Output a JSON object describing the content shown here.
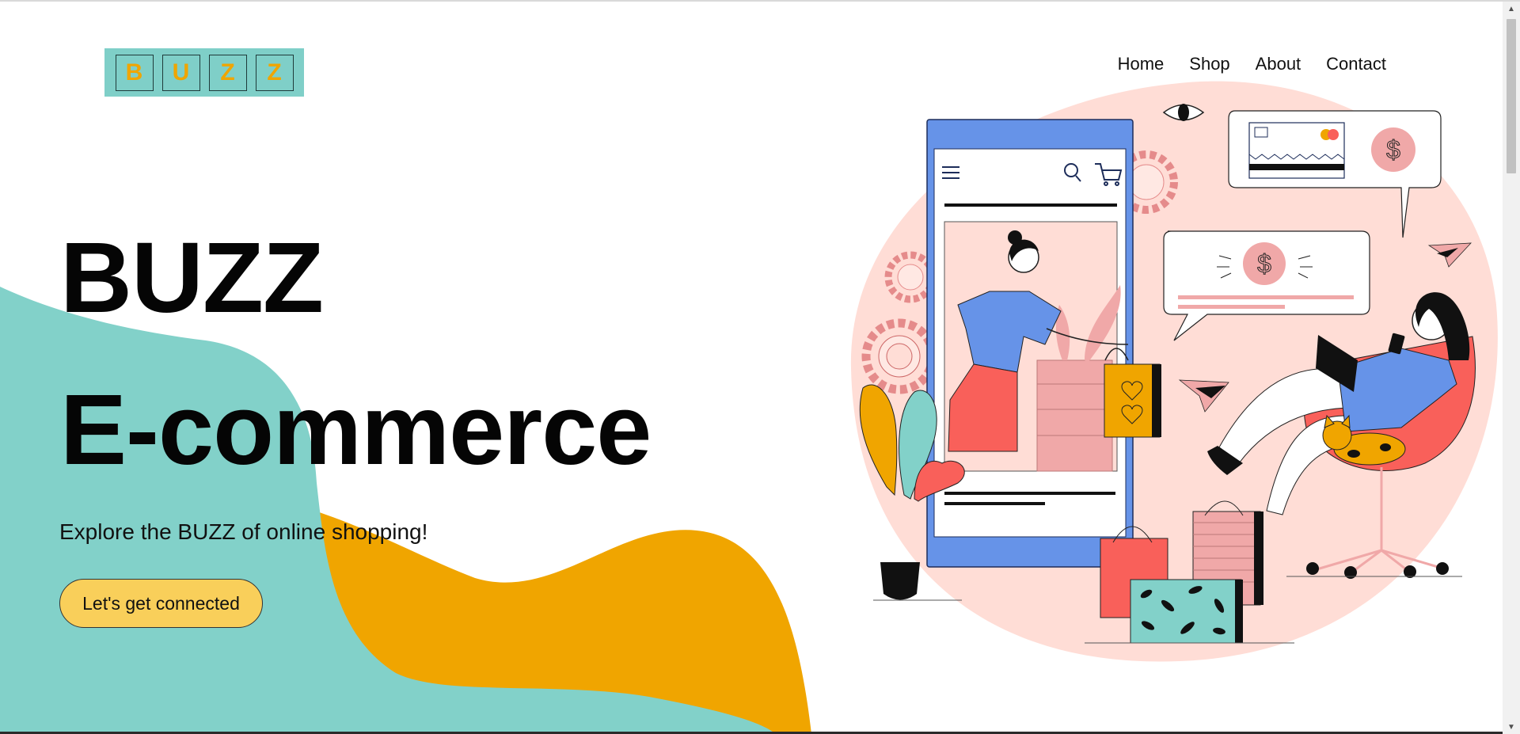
{
  "brand": {
    "logo_letters": [
      "B",
      "U",
      "Z",
      "Z"
    ]
  },
  "nav": {
    "items": [
      "Home",
      "Shop",
      "About",
      "Contact"
    ]
  },
  "hero": {
    "title_line1": "BUZZ",
    "title_line2": "E-commerce",
    "tagline": "Explore the BUZZ of online shopping!",
    "cta_label": "Let's get connected"
  },
  "illustration": {
    "currency_symbol": "$"
  },
  "colors": {
    "teal": "#82d1c9",
    "orange": "#f0a500",
    "pink": "#ffddd6",
    "blue": "#6693e8",
    "coral": "#f9605a",
    "cta_yellow": "#f9cf5a"
  },
  "scrollbar": {
    "up_icon": "▲",
    "down_icon": "▼"
  }
}
